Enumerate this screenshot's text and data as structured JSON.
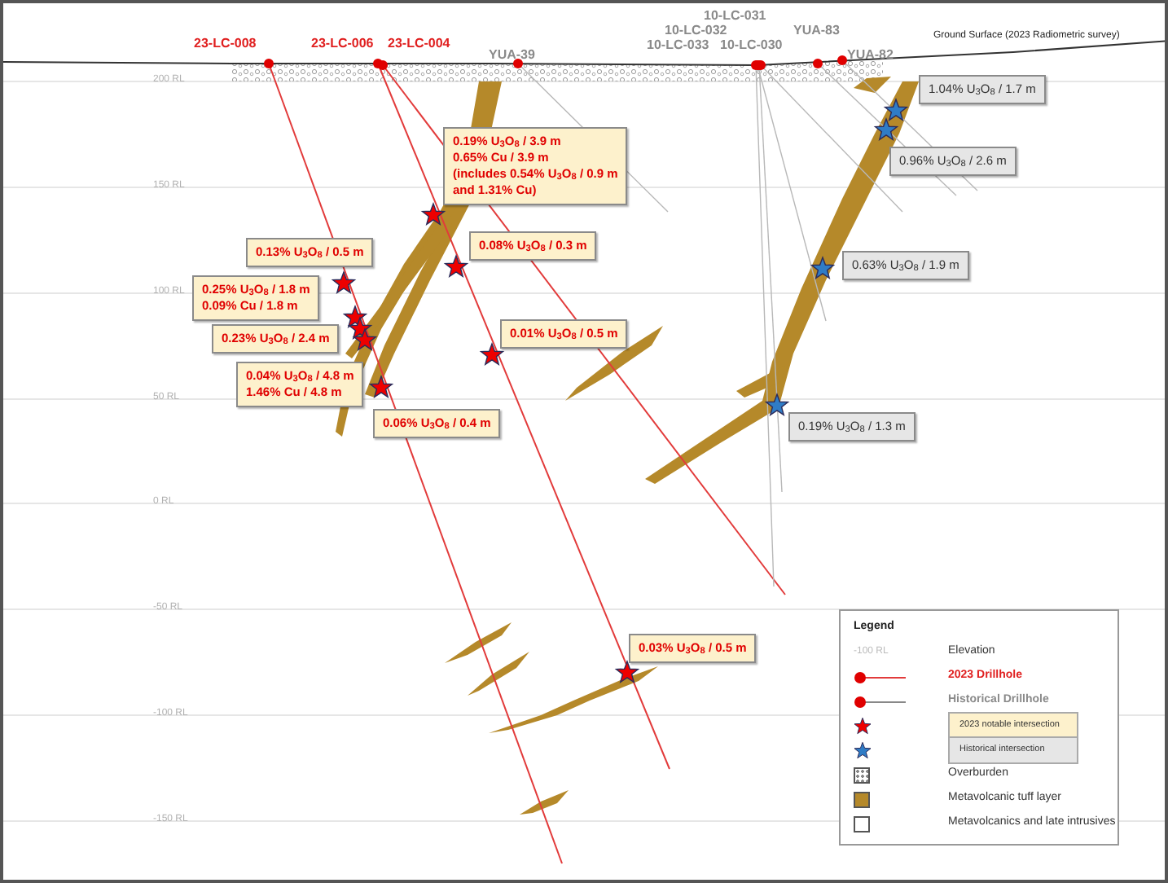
{
  "ground_surface_label": "Ground Surface (2023 Radiometric survey)",
  "elevation_labels": [
    "200 RL",
    "150 RL",
    "100 RL",
    "50 RL",
    "0 RL",
    "-50 RL",
    "-100 RL",
    "-150 RL"
  ],
  "drillholes": [
    {
      "name": "23-LC-008",
      "kind": "new"
    },
    {
      "name": "23-LC-006",
      "kind": "new"
    },
    {
      "name": "23-LC-004",
      "kind": "new"
    },
    {
      "name": "YUA-39",
      "kind": "historical"
    },
    {
      "name": "10-LC-031",
      "kind": "historical"
    },
    {
      "name": "10-LC-032",
      "kind": "historical"
    },
    {
      "name": "10-LC-033",
      "kind": "historical"
    },
    {
      "name": "10-LC-030",
      "kind": "historical"
    },
    {
      "name": "YUA-83",
      "kind": "historical"
    },
    {
      "name": "YUA-82",
      "kind": "historical"
    }
  ],
  "intersections": [
    {
      "kind": "notable",
      "lines": [
        "0.19% U$_{3}$O$_{8}$ / 3.9 m",
        "0.65% Cu / 3.9 m",
        "(includes 0.54% U$_{3}$O$_{8}$ / 0.9 m",
        "and 1.31% Cu)"
      ]
    },
    {
      "kind": "notable",
      "lines": [
        "0.08% U$_{3}$O$_{8}$ / 0.3 m"
      ]
    },
    {
      "kind": "notable",
      "lines": [
        "0.13% U$_{3}$O$_{8}$ / 0.5 m"
      ]
    },
    {
      "kind": "notable",
      "lines": [
        "0.25% U$_{3}$O$_{8}$ / 1.8 m",
        "0.09% Cu / 1.8 m"
      ]
    },
    {
      "kind": "notable",
      "lines": [
        "0.23% U$_{3}$O$_{8}$ / 2.4 m"
      ]
    },
    {
      "kind": "notable",
      "lines": [
        "0.04% U$_{3}$O$_{8}$ / 4.8 m",
        "1.46% Cu / 4.8 m"
      ]
    },
    {
      "kind": "notable",
      "lines": [
        "0.06% U$_{3}$O$_{8}$ / 0.4 m"
      ]
    },
    {
      "kind": "notable",
      "lines": [
        "0.01% U$_{3}$O$_{8}$ / 0.5 m"
      ]
    },
    {
      "kind": "notable",
      "lines": [
        "0.03% U$_{3}$O$_{8}$ / 0.5 m"
      ]
    },
    {
      "kind": "historical",
      "lines": [
        "1.04% U$_{3}$O$_{8}$ / 1.7 m"
      ]
    },
    {
      "kind": "historical",
      "lines": [
        "0.96% U$_{3}$O$_{8}$ / 2.6 m"
      ]
    },
    {
      "kind": "historical",
      "lines": [
        "0.63% U$_{3}$O$_{8}$ / 1.9 m"
      ]
    },
    {
      "kind": "historical",
      "lines": [
        "0.19% U$_{3}$O$_{8}$ / 1.3 m"
      ]
    }
  ],
  "legend": {
    "title": "Legend",
    "items": [
      {
        "kind": "elevation",
        "sample": "-100 RL",
        "label": "Elevation"
      },
      {
        "kind": "newhole",
        "label": "2023 Drillhole"
      },
      {
        "kind": "oldhole",
        "label": "Historical Drillhole"
      },
      {
        "kind": "notable",
        "label": "2023 notable intersection"
      },
      {
        "kind": "historical",
        "label": "Historical intersection"
      },
      {
        "kind": "overburden",
        "label": "Overburden"
      },
      {
        "kind": "tuff",
        "label": "Metavolcanic tuff layer"
      },
      {
        "kind": "host",
        "label": "Metavolcanics and late intrusives"
      }
    ]
  }
}
